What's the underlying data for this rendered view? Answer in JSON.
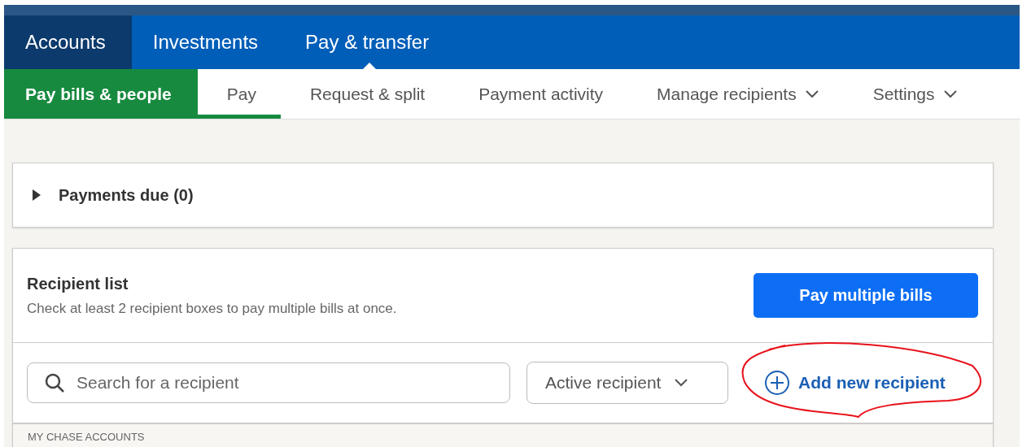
{
  "main_nav": [
    {
      "label": "Accounts",
      "selected": false,
      "hovered": true
    },
    {
      "label": "Investments",
      "selected": false,
      "hovered": false
    },
    {
      "label": "Pay & transfer",
      "selected": true,
      "hovered": false
    }
  ],
  "sub_nav": {
    "section": "Pay bills & people",
    "items": [
      {
        "label": "Pay",
        "selected": true,
        "has_menu": false
      },
      {
        "label": "Request & split",
        "selected": false,
        "has_menu": false
      },
      {
        "label": "Payment activity",
        "selected": false,
        "has_menu": false
      },
      {
        "label": "Manage recipients",
        "selected": false,
        "has_menu": true
      },
      {
        "label": "Settings",
        "selected": false,
        "has_menu": true
      }
    ]
  },
  "payments_due": {
    "label": "Payments due (0)",
    "expanded": false
  },
  "recipient_list": {
    "title": "Recipient list",
    "hint": "Check at least 2 recipient boxes to pay multiple bills at once.",
    "button": "Pay multiple bills",
    "search": {
      "placeholder": "Search for a recipient"
    },
    "filter": {
      "value": "Active recipient"
    },
    "add_link": "Add new recipient",
    "group_heading": "MY CHASE ACCOUNTS"
  }
}
